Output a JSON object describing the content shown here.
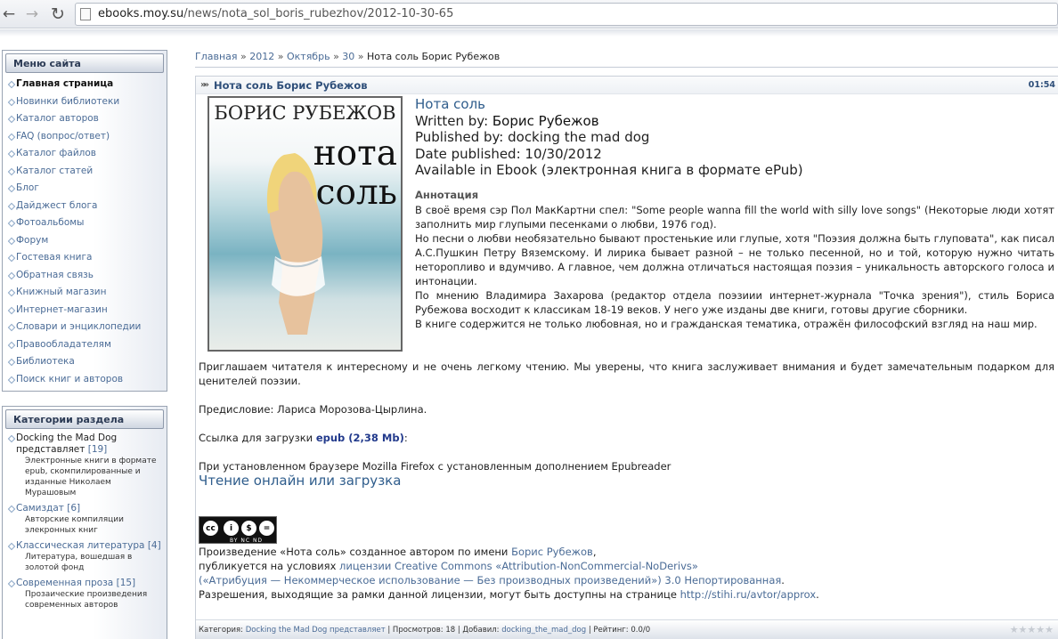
{
  "browser": {
    "url_host": "ebooks.moy.su",
    "url_path": "/news/nota_sol_boris_rubezhov/2012-10-30-65"
  },
  "sidebar": {
    "menu_title": "Меню сайта",
    "menu_items": [
      "Главная страница",
      "Новинки библиотеки",
      "Каталог авторов",
      "FAQ (вопрос/ответ)",
      "Каталог файлов",
      "Каталог статей",
      "Блог",
      "Дайджест блога",
      "Фотоальбомы",
      "Форум",
      "Гостевая книга",
      "Обратная связь",
      "Книжный магазин",
      "Интернет-магазин",
      "Словари и энциклопедии",
      "Правообладателям",
      "Библиотека",
      "Поиск книг и авторов"
    ],
    "categories_title": "Категории раздела",
    "categories": [
      {
        "title": "Docking the Mad Dog представляет",
        "count": "[19]",
        "desc": "Электронные книги в формате epub, скомпилированные и изданные Николаем Мурашовым"
      },
      {
        "title": "Самиздат",
        "count": "[6]",
        "desc": "Авторские компиляции элекронных книг"
      },
      {
        "title": "Классическая литература",
        "count": "[4]",
        "desc": "Литература, вошедшая в золотой фонд"
      },
      {
        "title": "Современная проза",
        "count": "[15]",
        "desc": "Прозаические произведения современных авторов"
      }
    ]
  },
  "breadcrumb": {
    "items": [
      "Главная",
      "2012",
      "Октябрь",
      "30"
    ],
    "separator": "»",
    "current": "Нота соль Борис Рубежов"
  },
  "entry": {
    "title": "Нота соль Борис Рубежов",
    "time": "01:54",
    "cover_author": "БОРИС РУБЕЖОВ",
    "cover_title_1": "нота",
    "cover_title_2": "соль",
    "book_title": "Нота соль",
    "written_by_label": "Written by: ",
    "written_by": "Борис Рубежов",
    "published_by": "Published by: docking the mad dog",
    "date_published": "Date published: 10/30/2012",
    "available": "Available in Ebook (электронная книга в формате ePub)",
    "annotation_label": "Аннотация",
    "annotation": [
      "В своё время сэр Пол МакКартни спел: \"Some people wanna fill the world with silly love songs\" (Некоторые люди хотят заполнить мир глупыми песенками о любви, 1976 год).",
      "Но песни о любви необязательно бывают простенькие или глупые, хотя \"Поэзия должна быть глуповата\", как писал А.С.Пушкин Петру Вяземскому. И лирика бывает разной – не только песенной, но и той, которую нужно читать неторопливо и вдумчиво. А главное, чем должна отличаться настоящая поэзия – уникальность авторского голоса и интонации.",
      "По мнению Владимира Захарова (редактор отдела поэзиии интернет-журнала \"Точка зрения\"), стиль Бориса Рубежова восходит к классикам 18-19 веков. У него уже изданы две книги, готовы другие сборники.",
      "В книге содержится не только любовная, но и гражданская тематика, отражён философский взгляд на наш мир."
    ],
    "annotation_tail": "Приглашаем читателя к интересному и не очень легкому чтению. Мы уверены, что книга заслуживает внимания и будет замечательным подарком для ценителей поэзии.",
    "preface": "Предисловие: Лариса Морозова-Цырлина.",
    "download_label": "Ссылка для загрузки ",
    "download_link": "epub (2,38 Mb)",
    "download_suffix": ":",
    "browser_note": "При установленном браузере Mozilla Firefox с установленным дополнением Epubreader",
    "reader_link": "Чтение онлайн или загрузка",
    "cc_labels": "BY NC ND",
    "license_1_pre": "Произведение «Нота соль» созданное автором по имени ",
    "license_1_link": "Борис Рубежов",
    "license_1_post": ",",
    "license_2_pre": "публикуется на условиях ",
    "license_2_link": "лицензии Creative Commons «Attribution-NonCommercial-NoDerivs»",
    "license_3_link": "(«Атрибуция — Некоммерческое использование — Без производных произведений») 3.0 Непортированная",
    "license_3_post": ".",
    "license_4_pre": "Разрешения, выходящие за рамки данной лицензии, могут быть доступны на странице ",
    "license_4_link": "http://stihi.ru/avtor/approx",
    "license_4_post": "."
  },
  "footer": {
    "category_label": "Категория: ",
    "category_link": "Docking the Mad Dog представляет",
    "views": " | Просмотров: 18 | Добавил: ",
    "added_by": "docking_the_mad_dog",
    "rating": " | Рейтинг: 0.0/0",
    "stars": "★★★★★"
  }
}
